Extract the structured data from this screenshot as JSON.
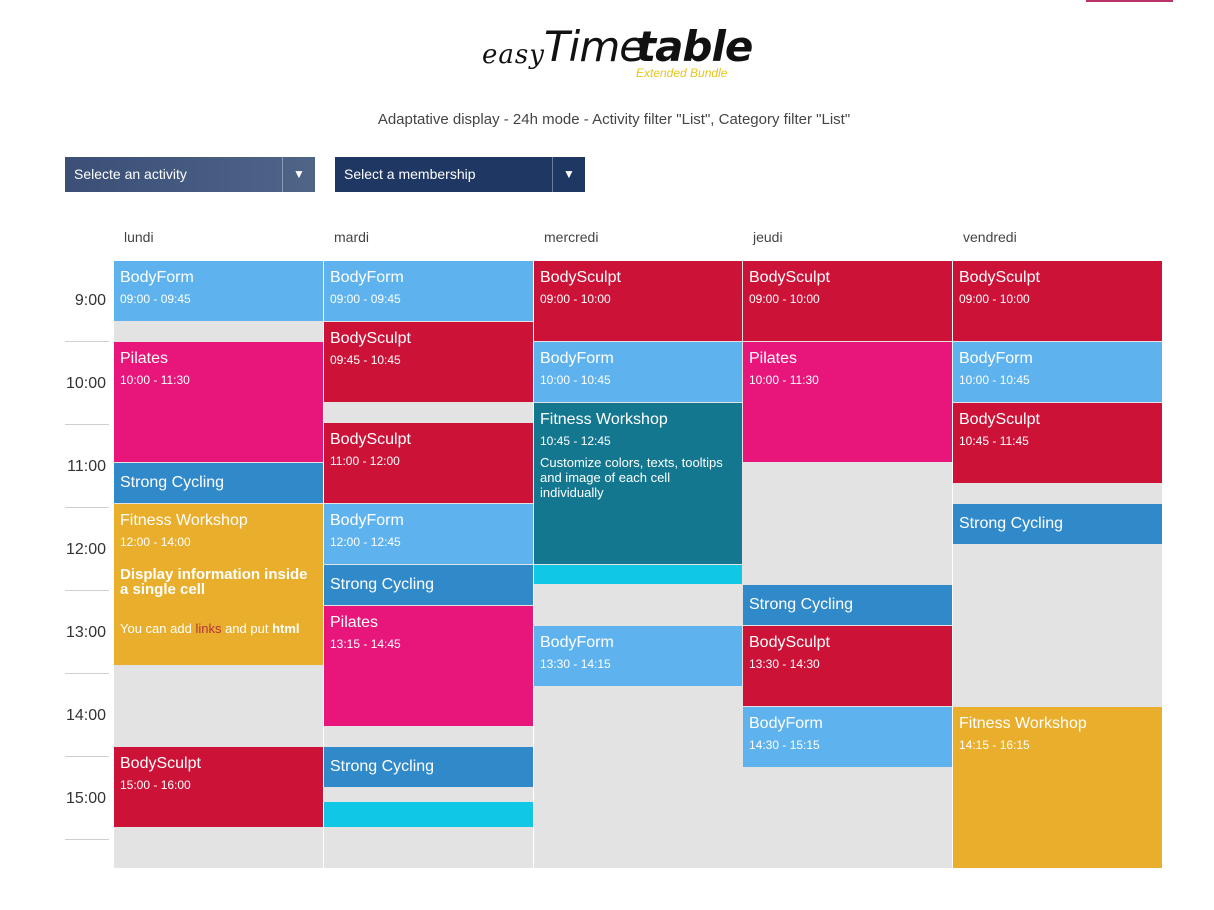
{
  "logo": {
    "easy": "easy",
    "time": "Time",
    "table": "table",
    "bundle": "Extended Bundle"
  },
  "subtitle": "Adaptative display - 24h mode - Activity filter \"List\", Category filter \"List\"",
  "filters": {
    "activity_placeholder": "Selecte an activity",
    "membership_placeholder": "Select a membership",
    "arrow_icon": "triangle-down"
  },
  "days": [
    "lundi",
    "mardi",
    "mercredi",
    "jeudi",
    "vendredi"
  ],
  "hours": [
    "9:00",
    "10:00",
    "11:00",
    "12:00",
    "13:00",
    "14:00",
    "15:00"
  ],
  "colors": {
    "lightblue": "#5eb3ef",
    "red": "#cd1238",
    "pink": "#e8157b",
    "blue": "#3089c9",
    "orange": "#e9ae2b",
    "teal": "#147790",
    "cyan": "#11c7e6",
    "empty": "#e3e3e3"
  },
  "events": {
    "lundi": [
      {
        "name": "BodyForm",
        "time": "09:00 - 09:45"
      },
      {
        "name": "Pilates",
        "time": "10:00 - 11:30"
      },
      {
        "name": "Strong Cycling"
      },
      {
        "name": "Fitness Workshop",
        "time": "12:00 - 14:00",
        "headline": "Display information inside a single cell",
        "note_pre": "You can add ",
        "note_link": "links",
        "note_mid": " and put ",
        "note_bold": "html"
      },
      {
        "name": "BodySculpt",
        "time": "15:00 - 16:00"
      }
    ],
    "mardi": [
      {
        "name": "BodyForm",
        "time": "09:00 - 09:45"
      },
      {
        "name": "BodySculpt",
        "time": "09:45 - 10:45"
      },
      {
        "name": "BodySculpt",
        "time": "11:00 - 12:00"
      },
      {
        "name": "BodyForm",
        "time": "12:00 - 12:45"
      },
      {
        "name": "Strong Cycling"
      },
      {
        "name": "Pilates",
        "time": "13:15 - 14:45"
      },
      {
        "name": "Strong Cycling"
      }
    ],
    "mercredi": [
      {
        "name": "BodySculpt",
        "time": "09:00 - 10:00"
      },
      {
        "name": "BodyForm",
        "time": "10:00 - 10:45"
      },
      {
        "name": "Fitness Workshop",
        "time": "10:45 - 12:45",
        "desc": "Customize colors, texts, tooltips and image of each cell individually"
      },
      {
        "name": "BodyForm",
        "time": "13:30 - 14:15"
      }
    ],
    "jeudi": [
      {
        "name": "BodySculpt",
        "time": "09:00 - 10:00"
      },
      {
        "name": "Pilates",
        "time": "10:00 - 11:30"
      },
      {
        "name": "Strong Cycling"
      },
      {
        "name": "BodySculpt",
        "time": "13:30 - 14:30"
      },
      {
        "name": "BodyForm",
        "time": "14:30 - 15:15"
      }
    ],
    "vendredi": [
      {
        "name": "BodySculpt",
        "time": "09:00 - 10:00"
      },
      {
        "name": "BodyForm",
        "time": "10:00 - 10:45"
      },
      {
        "name": "BodySculpt",
        "time": "10:45 - 11:45"
      },
      {
        "name": "Strong Cycling"
      },
      {
        "name": "Fitness Workshop",
        "time": "14:15 - 16:15"
      }
    ]
  }
}
